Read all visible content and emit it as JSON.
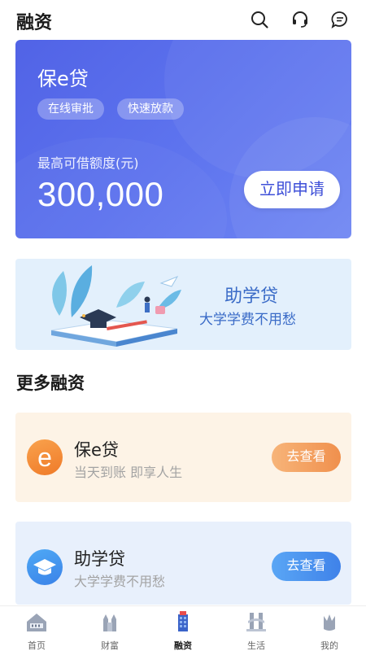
{
  "header": {
    "title": "融资",
    "icons": [
      "search-icon",
      "headset-icon",
      "chat-icon"
    ]
  },
  "hero": {
    "product_name": "保e贷",
    "tags": [
      "在线审批",
      "快速放款"
    ],
    "limit_label": "最高可借额度(元)",
    "amount": "300,000",
    "apply_label": "立即申请",
    "colors": {
      "gradient_start": "#5163e6",
      "gradient_end": "#6f86f3"
    }
  },
  "banner": {
    "title": "助学贷",
    "subtitle": "大学学费不用愁"
  },
  "section": {
    "title": "更多融资"
  },
  "products": [
    {
      "logo_glyph": "e",
      "name": "保e贷",
      "desc": "当天到账 即享人生",
      "button": "去查看",
      "accent": "#f0904d"
    },
    {
      "logo_glyph": "graduation-cap-icon",
      "name": "助学贷",
      "desc": "大学学费不用愁",
      "button": "去查看",
      "accent": "#3f82e9"
    }
  ],
  "tabbar": {
    "items": [
      {
        "label": "首页",
        "icon": "home-icon",
        "active": false
      },
      {
        "label": "财富",
        "icon": "wealth-icon",
        "active": false
      },
      {
        "label": "融资",
        "icon": "finance-icon",
        "active": true
      },
      {
        "label": "生活",
        "icon": "life-icon",
        "active": false
      },
      {
        "label": "我的",
        "icon": "profile-icon",
        "active": false
      }
    ]
  }
}
